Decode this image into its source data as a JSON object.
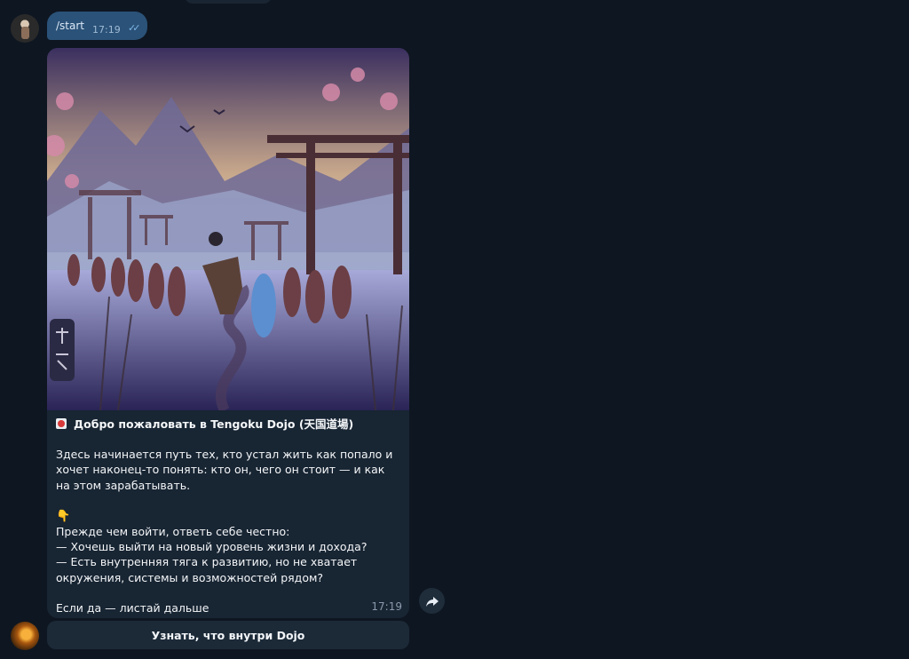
{
  "outgoing": {
    "text": "/start",
    "time": "17:19",
    "status_icon": "double-check-icon"
  },
  "message": {
    "title": "Добро пожаловать в Tengoku Dojo (天国道場)",
    "title_emoji": "mahjong-red-dragon-icon",
    "paragraph1": "Здесь начинается путь тех, кто устал жить как попало и хочет наконец-то понять: кто он, чего он стоит — и как на этом зарабатывать.",
    "hand_emoji": "pointing-down-hand-icon",
    "question_intro": "Прежде чем войти, ответь себе честно:",
    "question1": "— Хочешь выйти на новый уровень жизни и дохода?",
    "question2": "— Есть внутренняя тяга к развитию, но не хватает окружения, системы и возможностей рядом?",
    "closing": "Если да — листай дальше",
    "time": "17:19"
  },
  "inline_button": {
    "label": "Узнать, что внутри Dojo"
  },
  "colors": {
    "background": "#0e1621",
    "outgoing_bubble": "#2b5278",
    "incoming_bubble": "#182533",
    "button": "#1c2a38"
  }
}
